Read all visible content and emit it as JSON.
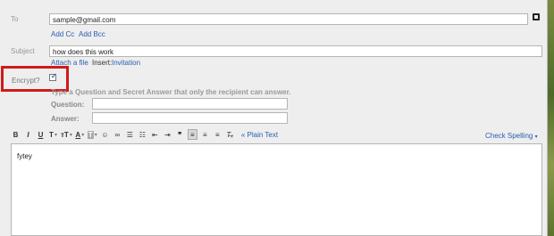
{
  "compose": {
    "to_label": "To",
    "to_value": "sample@gmail.com",
    "add_cc": "Add Cc",
    "add_bcc": "Add Bcc",
    "subject_label": "Subject",
    "subject_value": "how does this work",
    "attach_file": "Attach a file",
    "insert_label": "Insert:",
    "invitation": "Invitation"
  },
  "encrypt": {
    "label": "Encrypt?",
    "checked": true,
    "instruction": "Type a Question and Secret Answer that only the recipient can answer.",
    "question_label": "Question:",
    "answer_label": "Answer:",
    "question_value": "",
    "answer_value": ""
  },
  "toolbar": {
    "bold": "B",
    "italic": "I",
    "underline": "U",
    "font": "T",
    "size": "тT",
    "text_color": "A",
    "highlight": "T",
    "plain_text": "« Plain Text",
    "check_spelling": "Check Spelling"
  },
  "body": {
    "text": "fytey"
  },
  "colors": {
    "highlight_red": "#d11a1a",
    "link_blue": "#2a5db0"
  }
}
